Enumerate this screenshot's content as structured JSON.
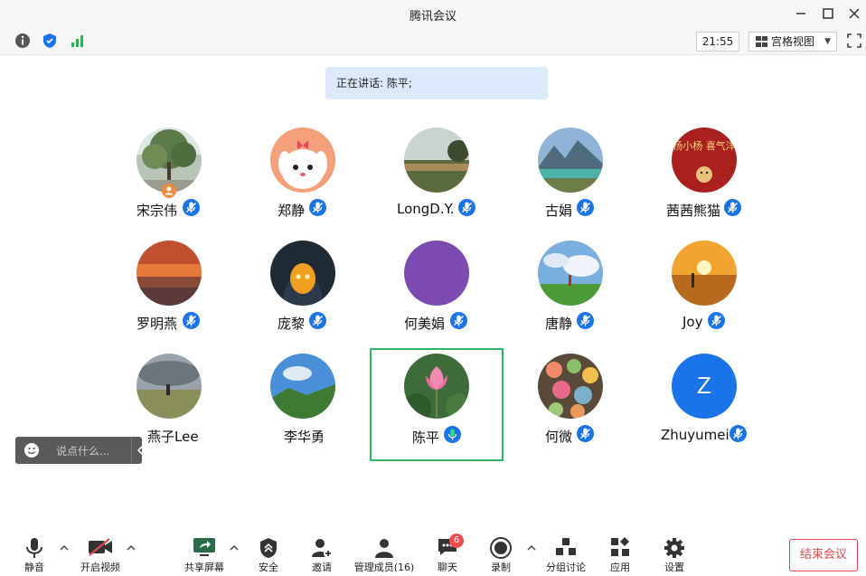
{
  "window": {
    "title": "腾讯会议"
  },
  "status": {
    "time": "21:55",
    "view_mode": "宫格视图"
  },
  "speaking_banner": "正在讲话: 陈平;",
  "participants": [
    {
      "name": "宋宗伟",
      "mic": "muted",
      "host": true
    },
    {
      "name": "郑静",
      "mic": "muted"
    },
    {
      "name": "LongD.Y.",
      "mic": "muted"
    },
    {
      "name": "古娟",
      "mic": "muted"
    },
    {
      "name": "茜茜熊猫",
      "mic": "muted",
      "avatar_text": "小杨小杨 喜气洋洋"
    },
    {
      "name": "罗明燕",
      "mic": "muted"
    },
    {
      "name": "庞黎",
      "mic": "muted"
    },
    {
      "name": "何美娟",
      "mic": "muted"
    },
    {
      "name": "唐静",
      "mic": "muted"
    },
    {
      "name": "Joy",
      "mic": "muted"
    },
    {
      "name": "燕子Lee",
      "mic": "none"
    },
    {
      "name": "李华勇",
      "mic": "none"
    },
    {
      "name": "陈平",
      "mic": "speaking",
      "active": true
    },
    {
      "name": "何微",
      "mic": "muted"
    },
    {
      "name": "Zhuyumei",
      "mic": "muted",
      "avatar_letter": "Z"
    }
  ],
  "chat_input": {
    "placeholder": "说点什么..."
  },
  "toolbar": {
    "mute": "静音",
    "video": "开启视频",
    "share": "共享屏幕",
    "security": "安全",
    "invite": "邀请",
    "members": "管理成员(16)",
    "chat": "聊天",
    "chat_badge": "6",
    "record": "录制",
    "breakout": "分组讨论",
    "apps": "应用",
    "settings": "设置",
    "end": "结束会议"
  },
  "colors": {
    "accent_blue": "#1a73e8",
    "speaking_green": "#2fb567",
    "end_red": "#e04b4b"
  }
}
